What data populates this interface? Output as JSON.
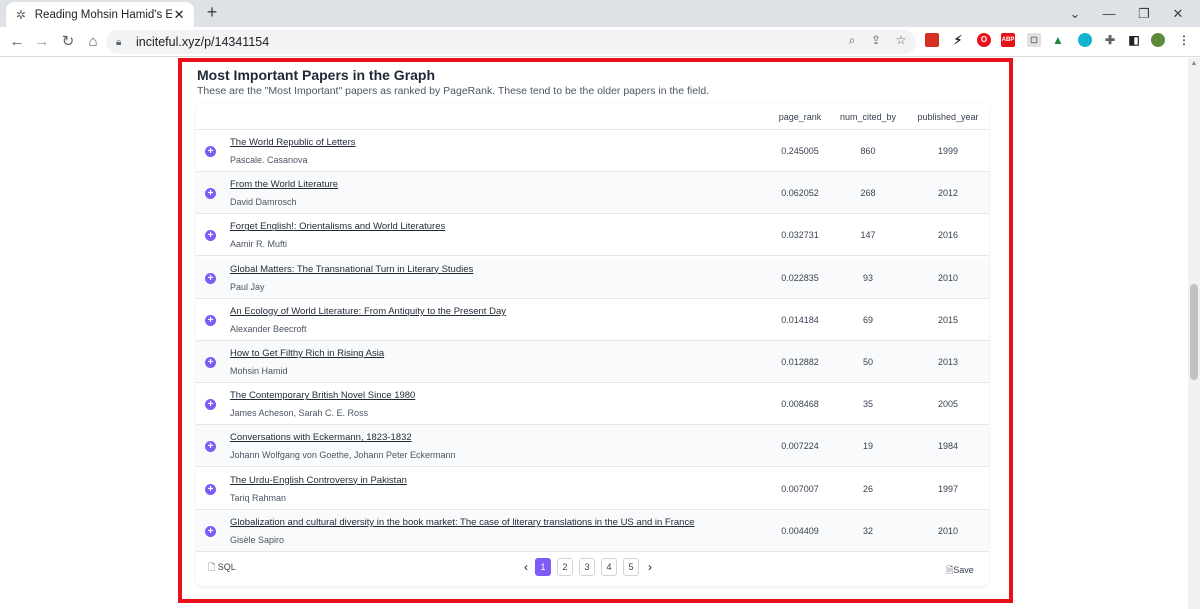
{
  "browser": {
    "tab_title": "Reading Mohsin Hamid's Exit We",
    "new_tab": "+",
    "url": "inciteful.xyz/p/14341154"
  },
  "section": {
    "title": "Most Important Papers in the Graph",
    "subtitle": "These are the \"Most Important\" papers as ranked by PageRank. These tend to be the older papers in the field."
  },
  "table": {
    "columns": [
      "page_rank",
      "num_cited_by",
      "published_year"
    ],
    "rows": [
      {
        "title": "The World Republic of Letters",
        "authors": "Pascale. Casanova",
        "page_rank": "0.245005",
        "num_cited_by": "860",
        "published_year": "1999"
      },
      {
        "title": "From the World Literature",
        "authors": "David Damrosch",
        "page_rank": "0.062052",
        "num_cited_by": "268",
        "published_year": "2012"
      },
      {
        "title": "Forget English!: Orientalisms and World Literatures",
        "authors": "Aamir R. Mufti",
        "page_rank": "0.032731",
        "num_cited_by": "147",
        "published_year": "2016"
      },
      {
        "title": "Global Matters: The Transnational Turn in Literary Studies",
        "authors": "Paul Jay",
        "page_rank": "0.022835",
        "num_cited_by": "93",
        "published_year": "2010"
      },
      {
        "title": "An Ecology of World Literature: From Antiquity to the Present Day",
        "authors": "Alexander Beecroft",
        "page_rank": "0.014184",
        "num_cited_by": "69",
        "published_year": "2015"
      },
      {
        "title": "How to Get Filthy Rich in Rising Asia",
        "authors": "Mohsin Hamid",
        "page_rank": "0.012882",
        "num_cited_by": "50",
        "published_year": "2013"
      },
      {
        "title": "The Contemporary British Novel Since 1980",
        "authors": "James Acheson, Sarah C. E. Ross",
        "page_rank": "0.008468",
        "num_cited_by": "35",
        "published_year": "2005"
      },
      {
        "title": "Conversations with Eckermann, 1823-1832",
        "authors": "Johann Wolfgang von Goethe, Johann Peter Eckermann",
        "page_rank": "0.007224",
        "num_cited_by": "19",
        "published_year": "1984"
      },
      {
        "title": "The Urdu-English Controversy in Pakistan",
        "authors": "Tariq Rahman",
        "page_rank": "0.007007",
        "num_cited_by": "26",
        "published_year": "1997"
      },
      {
        "title": "Globalization and cultural diversity in the book market: The case of literary translations in the US and in France",
        "authors": "Gisèle Sapiro",
        "page_rank": "0.004409",
        "num_cited_by": "32",
        "published_year": "2010"
      }
    ]
  },
  "footer": {
    "sql_label": "SQL",
    "save_label": "Save",
    "pages": [
      "1",
      "2",
      "3",
      "4",
      "5"
    ],
    "current_page": "1",
    "prev": "‹",
    "next": "›"
  },
  "colors": {
    "accent": "#7c5cf5",
    "highlight_border": "#e8111a"
  }
}
